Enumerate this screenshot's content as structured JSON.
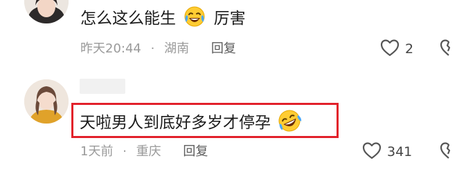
{
  "comments": [
    {
      "text_before": "怎么这么能生",
      "emoji": "crying-laughing-emoji",
      "text_after": "厉害",
      "time": "昨天20:44",
      "location": "湖南",
      "reply_label": "回复",
      "likes": "2"
    },
    {
      "text": "天啦男人到底好多岁才停孕",
      "emoji": "rolling-laughing-emoji",
      "time": "1天前",
      "location": "重庆",
      "reply_label": "回复",
      "likes": "341"
    }
  ],
  "separator": "·",
  "colors": {
    "highlight_border": "#e2202a",
    "meta_text": "#9a9a9a",
    "body_text": "#1b1b1b"
  }
}
